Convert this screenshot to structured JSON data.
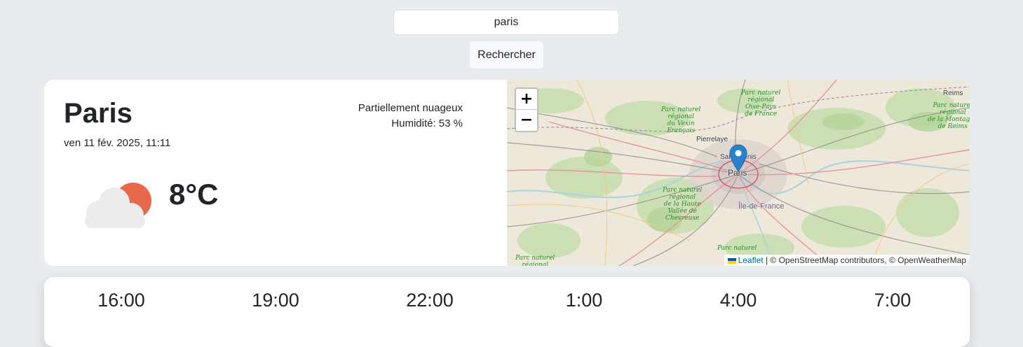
{
  "search": {
    "value": "paris",
    "button_label": "Rechercher"
  },
  "current": {
    "city": "Paris",
    "date": "ven 11 fév. 2025, 11:11",
    "description": "Partiellement nuageux",
    "humidity": "Humidité: 53 %",
    "temperature": "8°C",
    "icon": "partly-cloudy-icon"
  },
  "map": {
    "zoom_in": "+",
    "zoom_out": "−",
    "attribution_link": "Leaflet",
    "attribution_text": " | © OpenStreetMap contributors, © OpenWeatherMap",
    "labels": {
      "vexin": "Parc naturel\nrégional\ndu Vexin\nFrançais",
      "oise": "Parc naturel\nrégional\nOise-Pays\nde France",
      "reims_park": "Parc naturel\nrégional\nde la Montagne\nde Reims",
      "chevreuse": "Parc naturel\nrégional\nde la Haute\nVallée de\nChevreuse",
      "gatinais": "Parc naturel",
      "bottom_left": "Parc naturel\nrégional",
      "reims": "Reims",
      "pierrelaye": "Pierrelaye",
      "saint_denis": "Saint-Denis",
      "paris": "Paris",
      "idf": "Île-de-France"
    }
  },
  "forecast": {
    "hours": [
      "16:00",
      "19:00",
      "22:00",
      "1:00",
      "4:00",
      "7:00"
    ]
  },
  "colors": {
    "background": "#e9ecef",
    "card": "#ffffff",
    "sun": "#e8694a",
    "cloud": "#ececec",
    "marker": "#2a81cb"
  }
}
